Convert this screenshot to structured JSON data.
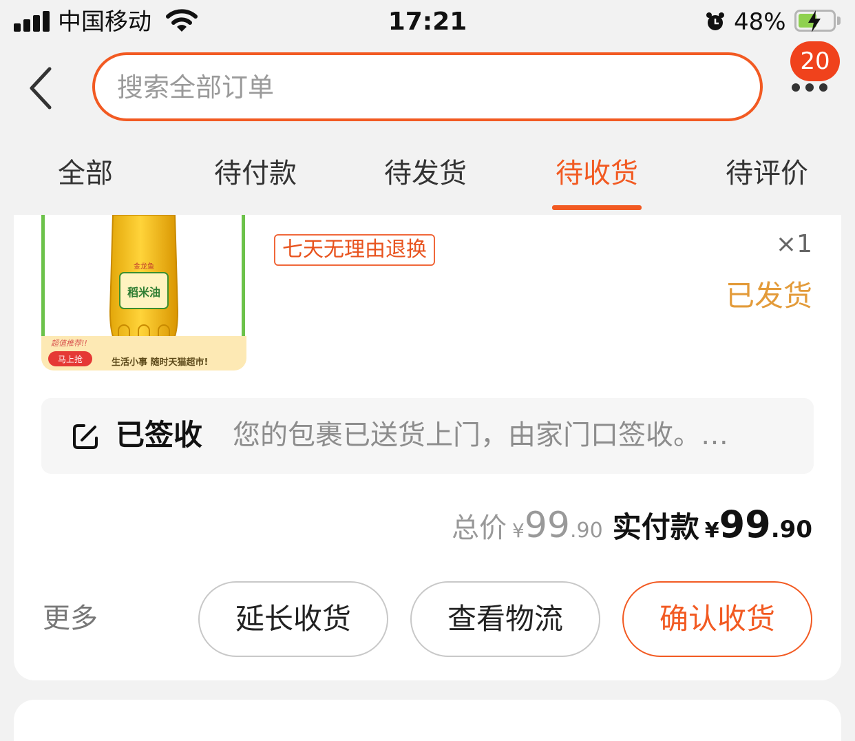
{
  "status_bar": {
    "carrier": "中国移动",
    "time": "17:21",
    "battery_percent": "48%",
    "battery_level": 0.48
  },
  "header": {
    "search_placeholder": "搜索全部订单",
    "badge_count": "20"
  },
  "tabs": [
    {
      "label": "全部",
      "active": false
    },
    {
      "label": "待付款",
      "active": false
    },
    {
      "label": "待发货",
      "active": false
    },
    {
      "label": "待收货",
      "active": true
    },
    {
      "label": "待评价",
      "active": false
    }
  ],
  "order": {
    "product_image": {
      "brand": "金龙鱼",
      "name": "稻米油",
      "promo_tag": "超值推荐!!",
      "promo_button": "马上抢",
      "slogan": "生活小事 随时天猫超市!"
    },
    "return_tag": "七天无理由退换",
    "quantity": "×1",
    "shipping_status": "已发货",
    "logistics": {
      "status": "已签收",
      "message": "您的包裹已送货上门，由家门口签收。…"
    },
    "price": {
      "total_label": "总价",
      "total_currency": "¥",
      "total_integer": "99",
      "total_decimal": ".90",
      "paid_label": "实付款",
      "paid_currency": "¥",
      "paid_integer": "99",
      "paid_decimal": ".90"
    },
    "actions": {
      "more": "更多",
      "extend": "延长收货",
      "logistics": "查看物流",
      "confirm": "确认收货"
    }
  },
  "colors": {
    "accent": "#f25a22",
    "shipped": "#e39b3a",
    "badge": "#f0421c"
  }
}
